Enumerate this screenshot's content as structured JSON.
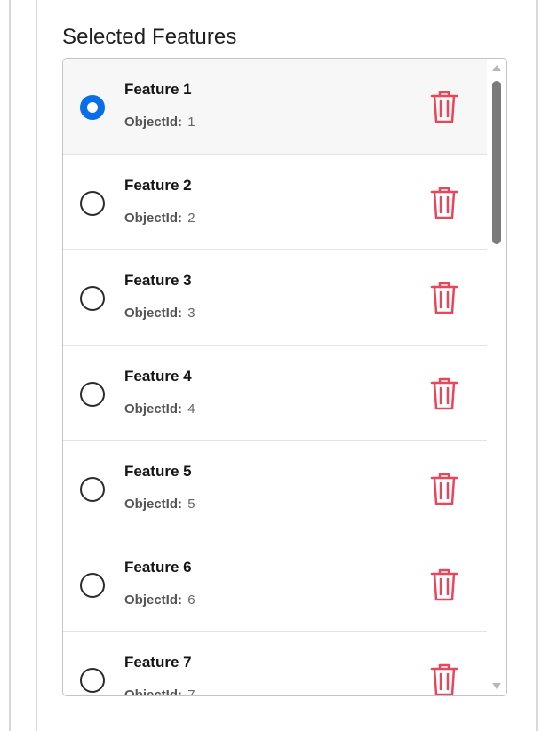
{
  "section": {
    "title": "Selected Features"
  },
  "features": [
    {
      "title": "Feature 1",
      "meta_key": "ObjectId:",
      "meta_value": "1",
      "selected": true
    },
    {
      "title": "Feature 2",
      "meta_key": "ObjectId:",
      "meta_value": "2",
      "selected": false
    },
    {
      "title": "Feature 3",
      "meta_key": "ObjectId:",
      "meta_value": "3",
      "selected": false
    },
    {
      "title": "Feature 4",
      "meta_key": "ObjectId:",
      "meta_value": "4",
      "selected": false
    },
    {
      "title": "Feature 5",
      "meta_key": "ObjectId:",
      "meta_value": "5",
      "selected": false
    },
    {
      "title": "Feature 6",
      "meta_key": "ObjectId:",
      "meta_value": "6",
      "selected": false
    },
    {
      "title": "Feature 7",
      "meta_key": "ObjectId:",
      "meta_value": "7",
      "selected": false
    }
  ],
  "colors": {
    "accent": "#0a6ee8",
    "delete": "#e8465a",
    "scrollbar_thumb": "#7b7b7b"
  },
  "icons": {
    "radio": "radio-button-icon",
    "delete": "trash-icon",
    "scroll_up": "scroll-up-arrow-icon",
    "scroll_down": "scroll-down-arrow-icon"
  }
}
